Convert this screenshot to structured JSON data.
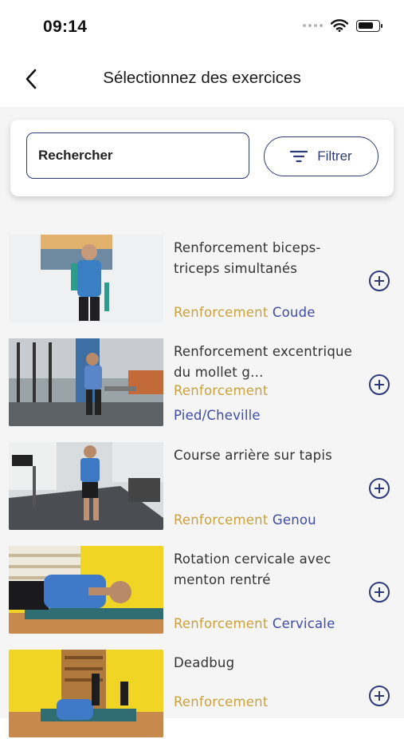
{
  "status_bar": {
    "time": "09:14"
  },
  "header": {
    "title": "Sélectionnez des exercices"
  },
  "search": {
    "placeholder": "Rechercher",
    "filter_label": "Filtrer"
  },
  "exercises": [
    {
      "title": "Renforcement biceps-triceps simultanés",
      "category": "Renforcement",
      "zone": "Coude"
    },
    {
      "title": "Renforcement excentrique du mollet g…",
      "category": "Renforcement",
      "zone": "Pied/Cheville"
    },
    {
      "title": "Course arrière sur tapis",
      "category": "Renforcement",
      "zone": "Genou"
    },
    {
      "title": "Rotation cervicale avec menton rentré",
      "category": "Renforcement",
      "zone": "Cervicale"
    },
    {
      "title": "Deadbug",
      "category": "Renforcement",
      "zone": ""
    }
  ],
  "colors": {
    "accent": "#2f3a7a",
    "category": "#c9a13f",
    "zone": "#3f4ba6"
  },
  "icons": {
    "back": "chevron-left-icon",
    "filter": "filter-icon",
    "add": "plus-circle-icon",
    "wifi": "wifi-icon",
    "battery": "battery-icon"
  }
}
